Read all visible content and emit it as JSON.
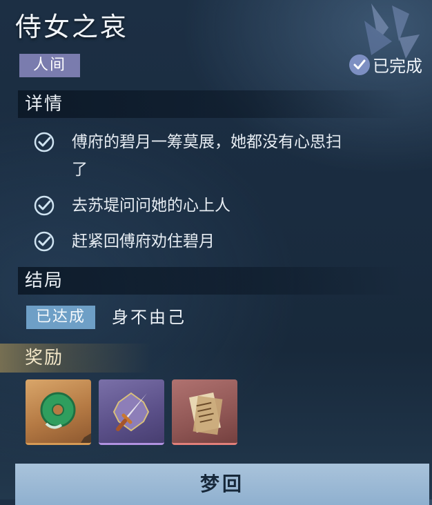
{
  "title": "侍女之哀",
  "tag": "人间",
  "status": {
    "label": "已完成",
    "icon": "check-circle-icon"
  },
  "details": {
    "heading": "详情",
    "tasks": [
      {
        "text": "傅府的碧月一筹莫展，她都没有心思扫",
        "text2": "了",
        "done": true
      },
      {
        "text": "去苏堤问问她的心上人",
        "done": true
      },
      {
        "text": "赶紧回傅府劝住碧月",
        "done": true
      }
    ]
  },
  "ending": {
    "heading": "结局",
    "badge": "已达成",
    "text": "身不由己"
  },
  "rewards": {
    "heading": "奖励",
    "items": [
      {
        "icon": "jade-pendant-icon",
        "rarity_color": "#d79a55"
      },
      {
        "icon": "dagger-icon",
        "rarity_color": "#b192e0"
      },
      {
        "icon": "letter-scroll-icon",
        "rarity_color": "#e2807a"
      }
    ]
  },
  "bottom_button": "梦回",
  "colors": {
    "tag_bg": "#7a7cae",
    "badge_bg": "#6e9fc6",
    "button_bg": "#9db8d3",
    "check": "#cfe3f1"
  }
}
